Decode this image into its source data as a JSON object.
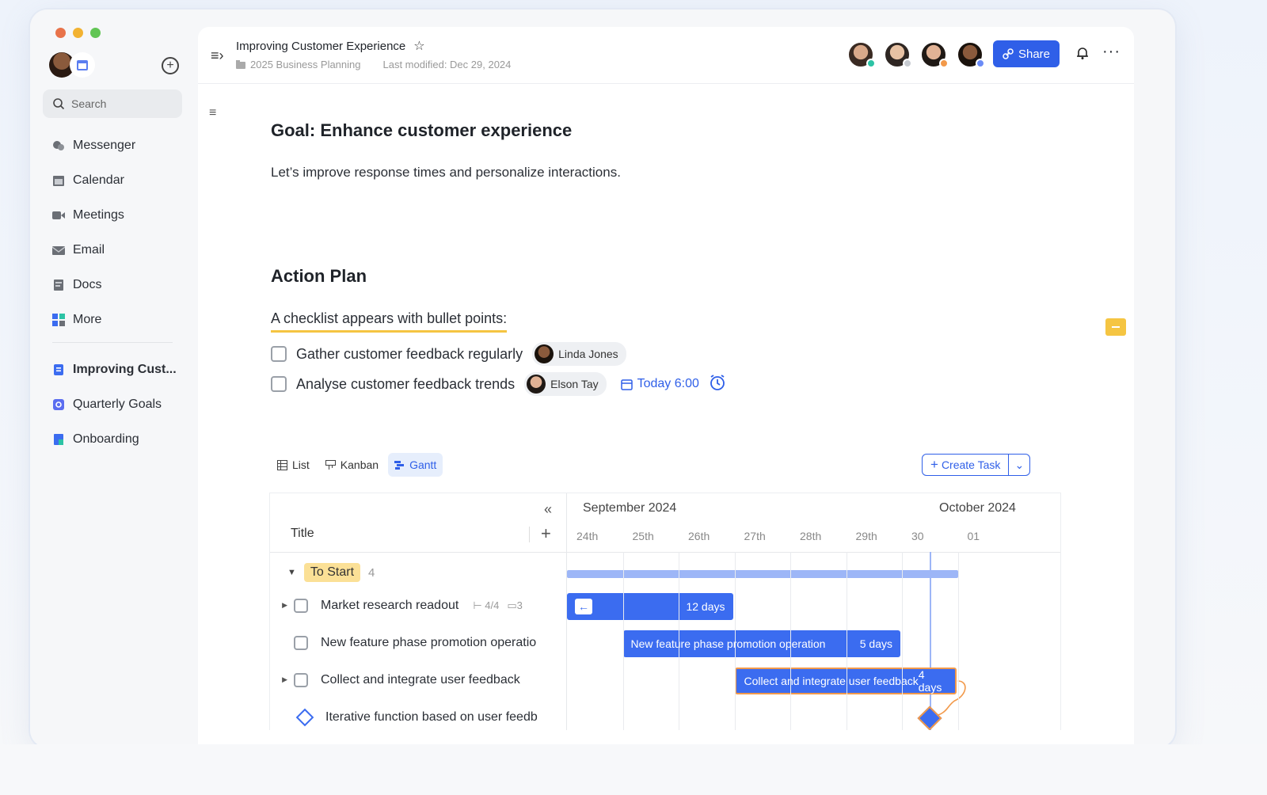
{
  "window": {
    "traffic": [
      "#e8734a",
      "#f2b232",
      "#61c554"
    ]
  },
  "sidebar": {
    "search_placeholder": "Search",
    "nav": [
      {
        "label": "Messenger",
        "icon": "chat-bubbles-icon"
      },
      {
        "label": "Calendar",
        "icon": "calendar-icon"
      },
      {
        "label": "Meetings",
        "icon": "video-camera-icon"
      },
      {
        "label": "Email",
        "icon": "envelope-icon"
      },
      {
        "label": "Docs",
        "icon": "doc-icon"
      },
      {
        "label": "More",
        "icon": "grid-icon"
      }
    ],
    "docs": [
      {
        "label": "Improving Cust...",
        "icon": "doc-blue-icon",
        "active": true
      },
      {
        "label": "Quarterly Goals",
        "icon": "goals-icon"
      },
      {
        "label": "Onboarding",
        "icon": "sheet-icon"
      }
    ]
  },
  "header": {
    "title": "Improving Customer Experience",
    "folder": "2025 Business Planning",
    "last_modified": "Last modified: Dec 29, 2024",
    "share_label": "Share",
    "collaborator_status": [
      "#2cc3a5",
      "#c7cbd1",
      "#f2994a",
      "#6b8cf7"
    ]
  },
  "doc": {
    "goal_heading": "Goal: Enhance customer experience",
    "goal_text": "Let’s improve response times and personalize interactions.",
    "plan_heading": "Action Plan",
    "checklist_intro": "A checklist appears with bullet points:",
    "checklist": [
      {
        "text": "Gather customer feedback regularly",
        "assignee": "Linda Jones"
      },
      {
        "text": "Analyse customer feedback trends",
        "assignee": "Elson Tay",
        "due": "Today 6:00"
      }
    ]
  },
  "views": {
    "list": "List",
    "kanban": "Kanban",
    "gantt": "Gantt",
    "active": "gantt"
  },
  "create_task_label": "Create Task",
  "gantt": {
    "title_col": "Title",
    "months": [
      "September 2024",
      "October 2024"
    ],
    "days": [
      "24th",
      "25th",
      "26th",
      "27th",
      "28th",
      "29th",
      "30",
      "01"
    ],
    "group": {
      "label": "To Start",
      "count": "4"
    },
    "rows": [
      {
        "title": "Market research readout",
        "subtasks": "4/4",
        "comments": "3",
        "bar_label": "12 days",
        "start": "24th",
        "end": "26th"
      },
      {
        "title": "New feature phase promotion operatio",
        "bar_text": "New feature phase promotion operation",
        "bar_label": "5 days",
        "start": "25th",
        "end": "29th"
      },
      {
        "title": "Collect and integrate user feedback",
        "bar_text": "Collect and integrate user feedback",
        "bar_label": "4 days",
        "start": "27th",
        "end": "30"
      },
      {
        "title": "Iterative function based on user feedb",
        "milestone": true,
        "date": "30"
      }
    ]
  }
}
